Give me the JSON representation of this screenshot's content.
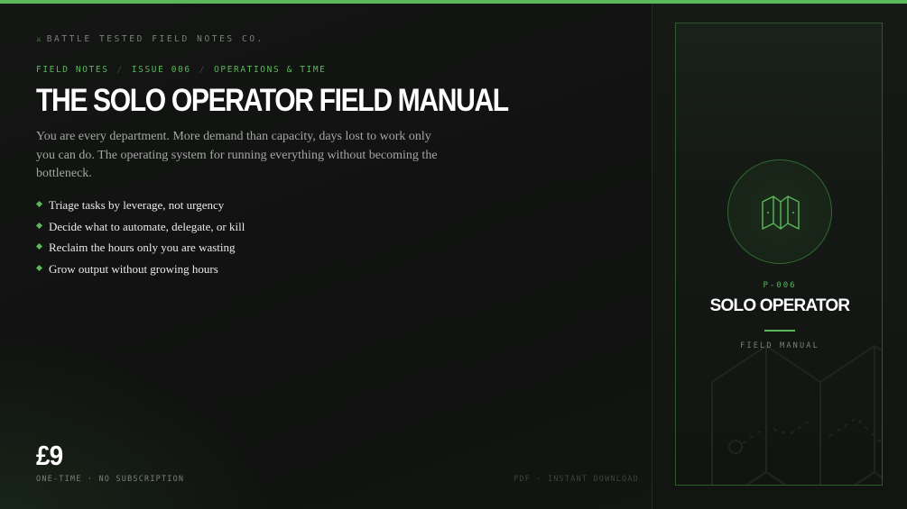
{
  "brand": {
    "icon": "crossed-swords-icon",
    "name": "BATTLE TESTED FIELD NOTES CO."
  },
  "breadcrumb": [
    "FIELD NOTES",
    "ISSUE 006",
    "OPERATIONS & TIME"
  ],
  "title": "THE SOLO OPERATOR FIELD MANUAL",
  "description": "You are every department. More demand than capacity, days lost to work only you can do. The operating system for running everything without becoming the bottleneck.",
  "features": [
    "Triage tasks by leverage, not urgency",
    "Decide what to automate, delegate, or kill",
    "Reclaim the hours only you are wasting",
    "Grow output without growing hours"
  ],
  "price": {
    "amount": "£9",
    "note": "ONE-TIME · NO SUBSCRIPTION"
  },
  "format_note": "PDF · INSTANT DOWNLOAD",
  "card": {
    "icon": "folded-map-icon",
    "code": "P-006",
    "title": "SOLO OPERATOR",
    "subtitle": "FIELD MANUAL"
  },
  "colors": {
    "accent": "#5cb85c",
    "background": "#111311",
    "text": "#ffffff"
  }
}
